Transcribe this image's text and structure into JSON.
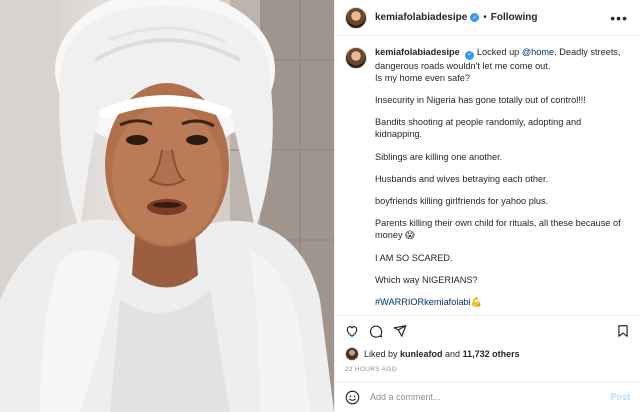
{
  "header": {
    "username": "kemiafolabiadesipe",
    "separator": "•",
    "follow_state": "Following",
    "more_icon": "ellipsis-icon",
    "verified_icon": "verified-badge-icon"
  },
  "caption": {
    "username": "kemiafolabiadesipe",
    "opening": "Locked up ",
    "mention": "@home",
    "opening_rest": ". Deadly streets, dangerous roads wouldn't let me come out.",
    "line2": "Is my home even safe?",
    "paragraphs": [
      "Insecurity in Nigeria has gone totally out of control!!!",
      "Bandits shooting at people randomly, adopting and kidnapping.",
      "Siblings are killing one another.",
      "Husbands and wives betraying each other.",
      "boyfriends killing girlfriends for yahoo plus.",
      "Parents killing their own child for rituals, all these because of money 😱",
      "I AM SO SCARED.",
      "Which way NIGERIANS?"
    ],
    "hashtag": "#WARRIORkemiafolabi",
    "hashtag_emoji": "💪"
  },
  "actions": {
    "like_icon": "heart-icon",
    "comment_icon": "comment-icon",
    "share_icon": "share-icon",
    "save_icon": "bookmark-icon"
  },
  "likes": {
    "prefix": "Liked by ",
    "user": "kunleafod",
    "middle": " and ",
    "count": "11,732 others"
  },
  "timestamp": "22 HOURS AGO",
  "comment": {
    "emoji_icon": "smiley-icon",
    "placeholder": "Add a comment...",
    "post_label": "Post"
  },
  "colors": {
    "link": "#00376b",
    "verified": "#3897f0",
    "post_disabled": "#b2dffc",
    "muted": "#8e8e8e"
  }
}
